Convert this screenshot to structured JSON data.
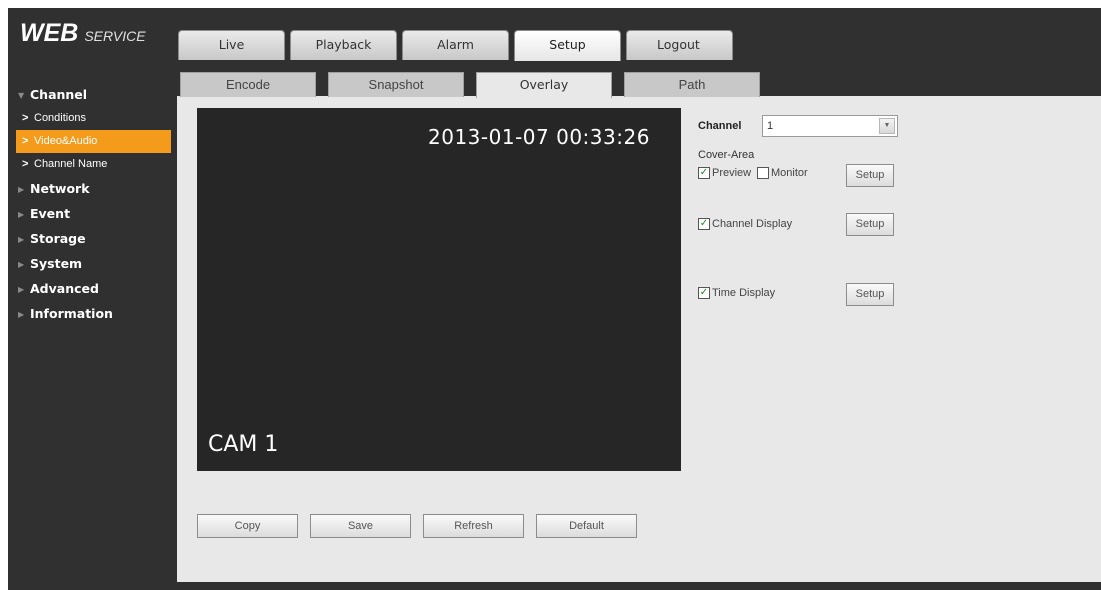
{
  "brand": {
    "main": "WEB",
    "sub": "SERVICE"
  },
  "top_tabs": [
    {
      "label": "Live",
      "active": false
    },
    {
      "label": "Playback",
      "active": false
    },
    {
      "label": "Alarm",
      "active": false
    },
    {
      "label": "Setup",
      "active": true
    },
    {
      "label": "Logout",
      "active": false
    }
  ],
  "sidebar": {
    "channel": "Channel",
    "channel_items": [
      {
        "label": "Conditions",
        "active": false
      },
      {
        "label": "Video&Audio",
        "active": true
      },
      {
        "label": "Channel Name",
        "active": false
      }
    ],
    "network": "Network",
    "event": "Event",
    "storage": "Storage",
    "system": "System",
    "advanced": "Advanced",
    "information": "Information"
  },
  "sub_tabs": [
    {
      "label": "Encode",
      "active": false
    },
    {
      "label": "Snapshot",
      "active": false
    },
    {
      "label": "Overlay",
      "active": true
    },
    {
      "label": "Path",
      "active": false
    }
  ],
  "video": {
    "timestamp": "2013-01-07 00:33:26",
    "camera_name": "CAM 1"
  },
  "settings": {
    "channel_label": "Channel",
    "channel_value": "1",
    "cover_area_label": "Cover-Area",
    "preview_label": "Preview",
    "preview_checked": true,
    "monitor_label": "Monitor",
    "monitor_checked": false,
    "channel_display_label": "Channel Display",
    "channel_display_checked": true,
    "time_display_label": "Time Display",
    "time_display_checked": true,
    "setup_label": "Setup"
  },
  "actions": {
    "copy": "Copy",
    "save": "Save",
    "refresh": "Refresh",
    "default": "Default"
  },
  "colors": {
    "background": "#303030",
    "content": "#e8e8e8",
    "accent": "#f59b1c",
    "video_bg": "#262626"
  }
}
